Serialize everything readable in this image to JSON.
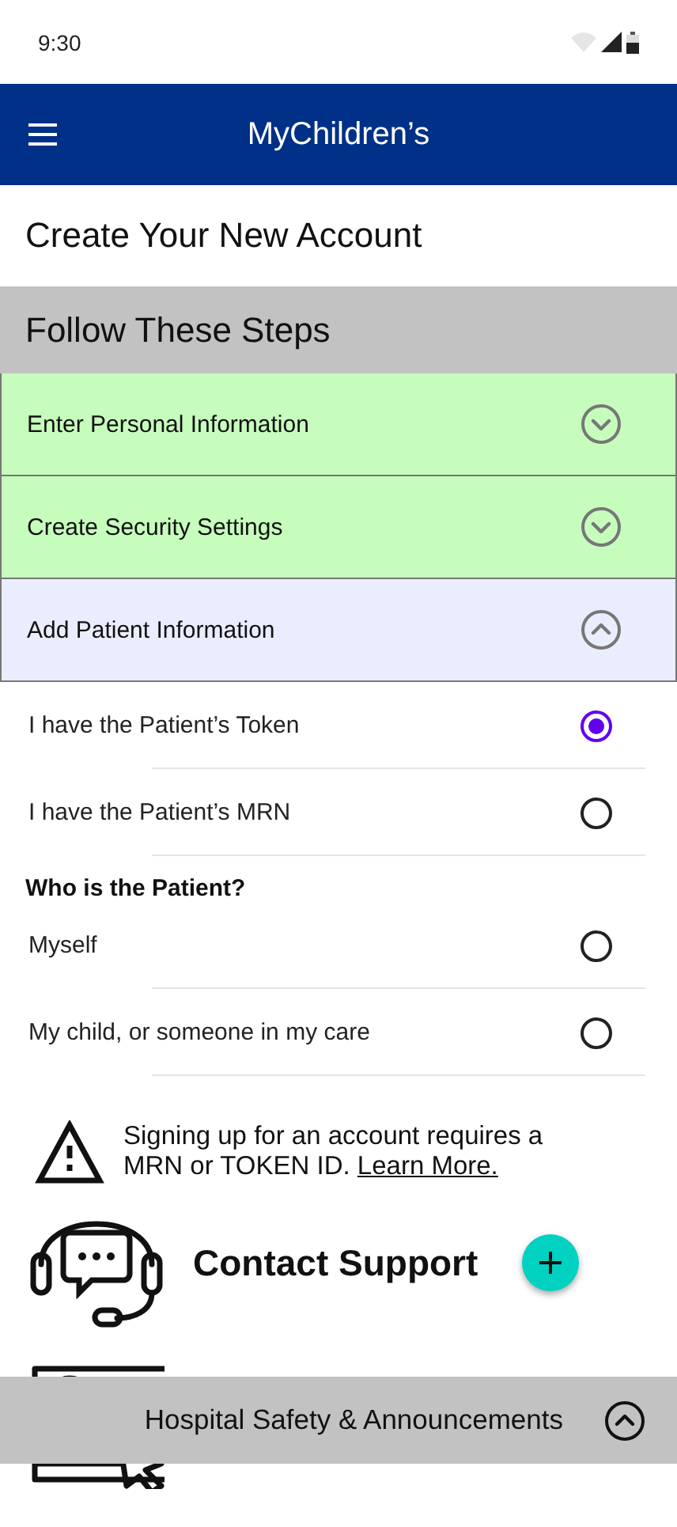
{
  "status_bar": {
    "time": "9:30"
  },
  "app_bar": {
    "title": "MyChildren’s"
  },
  "page_title": "Create Your New Account",
  "steps_header": "Follow These Steps",
  "steps": [
    {
      "label": "Enter Personal Information",
      "completed": true,
      "expanded": false
    },
    {
      "label": "Create Security Settings",
      "completed": true,
      "expanded": false
    },
    {
      "label": "Add Patient Information",
      "completed": false,
      "expanded": true
    }
  ],
  "id_options": [
    {
      "label": "I have the Patient’s Token",
      "selected": true
    },
    {
      "label": "I have the Patient’s MRN",
      "selected": false
    }
  ],
  "patient_question": "Who is the Patient?",
  "patient_options": [
    {
      "label": "Myself",
      "selected": false
    },
    {
      "label": "My child, or someone in my care",
      "selected": false
    }
  ],
  "notice": {
    "text": "Signing up for an account requires a MRN or TOKEN ID.",
    "link": "Learn More."
  },
  "actions": [
    {
      "kind": "support",
      "label": "Contact Support"
    },
    {
      "kind": "instructions"
    }
  ],
  "bottom_bar": {
    "label": "Hospital Safety & Announcements",
    "expanded": false
  }
}
